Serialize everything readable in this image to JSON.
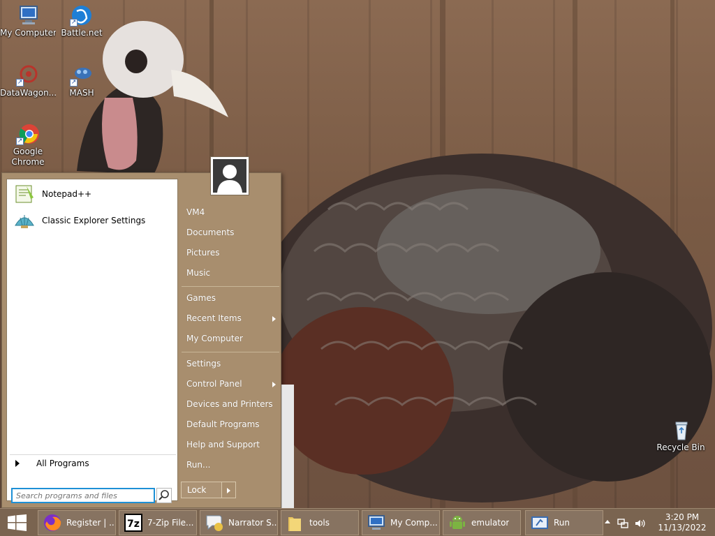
{
  "desktop": {
    "icons": [
      {
        "label": "My Computer",
        "icon": "my-computer-icon"
      },
      {
        "label": "Battle.net",
        "icon": "battlenet-icon"
      },
      {
        "label": "DataWagon...",
        "icon": "datawagon-icon"
      },
      {
        "label": "MASH",
        "icon": "mash-icon"
      },
      {
        "label": "Google Chrome",
        "icon": "chrome-icon"
      },
      {
        "label": "Recycle Bin",
        "icon": "recycle-bin-icon"
      }
    ]
  },
  "start_menu": {
    "pinned": [
      {
        "label": "Notepad++",
        "icon": "notepadpp-icon"
      },
      {
        "label": "Classic Explorer Settings",
        "icon": "classic-shell-icon"
      }
    ],
    "all_programs": "All Programs",
    "search_placeholder": "Search programs and files",
    "right_items": [
      {
        "label": "VM4"
      },
      {
        "label": "Documents"
      },
      {
        "label": "Pictures"
      },
      {
        "label": "Music"
      },
      {
        "label": "Games"
      },
      {
        "label": "Recent Items",
        "submenu": true
      },
      {
        "label": "My Computer"
      },
      {
        "label": "Settings"
      },
      {
        "label": "Control Panel",
        "submenu": true
      },
      {
        "label": "Devices and Printers"
      },
      {
        "label": "Default Programs"
      },
      {
        "label": "Help and Support"
      },
      {
        "label": "Run..."
      }
    ],
    "lock_label": "Lock"
  },
  "taskbar": {
    "buttons": [
      {
        "label": "Register | ...",
        "icon": "firefox-icon"
      },
      {
        "label": "7-Zip File...",
        "icon": "7zip-icon"
      },
      {
        "label": "Narrator S...",
        "icon": "narrator-icon"
      },
      {
        "label": "tools",
        "icon": "folder-icon"
      },
      {
        "label": "My Comp...",
        "icon": "my-computer-icon"
      },
      {
        "label": "emulator",
        "icon": "android-icon"
      },
      {
        "label": "Run",
        "icon": "run-icon"
      }
    ],
    "clock_time": "3:20 PM",
    "clock_date": "11/13/2022"
  },
  "colors": {
    "menu_background": "#a88e6e",
    "taskbar_background": "#7a6450",
    "search_border": "#1e90d6"
  }
}
